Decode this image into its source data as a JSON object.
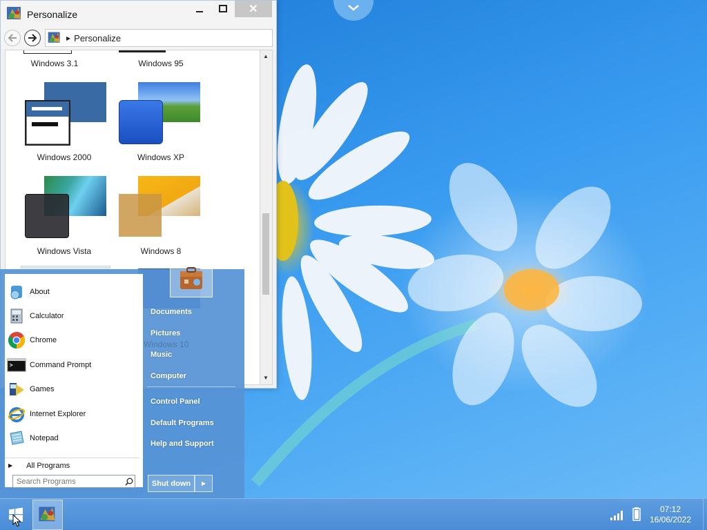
{
  "window": {
    "title": "Personalize",
    "breadcrumb": "Personalize",
    "close_glyph": "✕"
  },
  "themes": [
    {
      "label": "Windows 3.1"
    },
    {
      "label": "Windows 95"
    },
    {
      "label": "Windows 2000"
    },
    {
      "label": "Windows XP"
    },
    {
      "label": "Windows Vista"
    },
    {
      "label": "Windows 8"
    },
    {
      "label": "Windows 10"
    }
  ],
  "start_menu": {
    "programs": [
      {
        "label": "About",
        "icon": "about-icon"
      },
      {
        "label": "Calculator",
        "icon": "calculator-icon"
      },
      {
        "label": "Chrome",
        "icon": "chrome-icon"
      },
      {
        "label": "Command Prompt",
        "icon": "command-prompt-icon"
      },
      {
        "label": "Games",
        "icon": "games-icon"
      },
      {
        "label": "Internet Explorer",
        "icon": "internet-explorer-icon"
      },
      {
        "label": "Notepad",
        "icon": "notepad-icon"
      }
    ],
    "all_programs": "All Programs",
    "search_placeholder": "Search Programs",
    "right_links": [
      "Documents",
      "Pictures",
      "Music",
      "Computer",
      "Control Panel",
      "Default Programs",
      "Help and Support"
    ],
    "shutdown_label": "Shut down"
  },
  "taskbar": {
    "time": "07:12",
    "date": "16/06/2022"
  },
  "colors": {
    "accent": "#5693d5",
    "taskbar": "#4a8cd6",
    "desktop": "#2f8fe0"
  }
}
